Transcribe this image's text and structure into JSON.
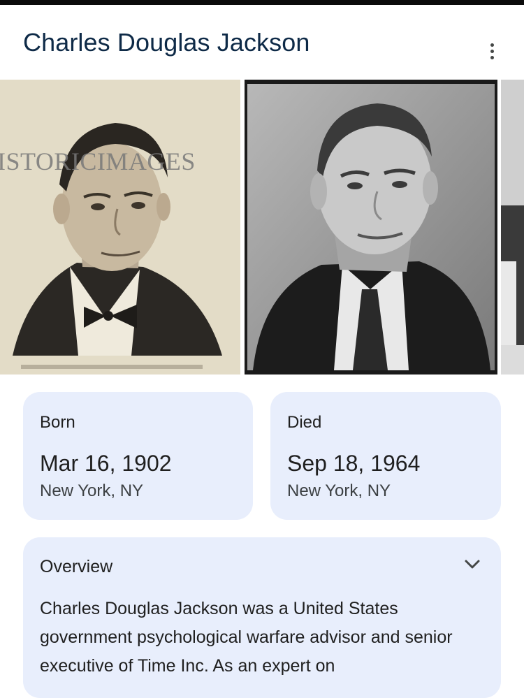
{
  "header": {
    "title": "Charles Douglas Jackson",
    "more_icon": "more-vert-icon"
  },
  "photos": [
    {
      "watermark": "ISTORICIMAGES",
      "tone": "sepia"
    },
    {
      "tone": "black-and-white"
    },
    {
      "tone": "partial"
    }
  ],
  "born": {
    "label": "Born",
    "date": "Mar 16, 1902",
    "place": "New York, NY"
  },
  "died": {
    "label": "Died",
    "date": "Sep 18, 1964",
    "place": "New York, NY"
  },
  "overview": {
    "title": "Overview",
    "toggle_icon": "chevron-down-icon",
    "text": "Charles Douglas Jackson was a United States government psychological warfare advisor and senior executive of Time Inc. As an expert on"
  },
  "colors": {
    "title": "#0e2a47",
    "card_background": "#e8eefc",
    "top_bar": "#0b0b0b"
  }
}
